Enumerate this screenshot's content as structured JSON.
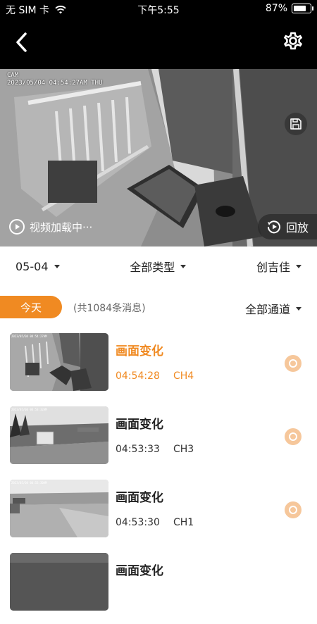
{
  "status_bar": {
    "carrier": "无 SIM 卡",
    "time": "下午5:55",
    "battery_percent": "87%",
    "battery_level": 0.87
  },
  "player": {
    "osd_name": "CAM",
    "osd_timestamp": "2023/05/04 04:54:27AM THU",
    "loading_text": "视频加载中···",
    "playback_label": "回放"
  },
  "filters": {
    "date": "05-04",
    "type": "全部类型",
    "brand": "创吉佳"
  },
  "summary": {
    "today_label": "今天",
    "count_text": "(共1084条消息)",
    "channel_filter": "全部通道"
  },
  "events": [
    {
      "title": "画面变化",
      "time": "04:54:28",
      "channel": "CH4",
      "active": true
    },
    {
      "title": "画面变化",
      "time": "04:53:33",
      "channel": "CH3",
      "active": false
    },
    {
      "title": "画面变化",
      "time": "04:53:30",
      "channel": "CH1",
      "active": false
    },
    {
      "title": "画面变化",
      "time": "",
      "channel": "",
      "active": false
    }
  ],
  "colors": {
    "accent": "#f08a22",
    "accent_light": "#f6c79b",
    "bar_background": "#000000"
  },
  "icons": {
    "back": "chevron-left-icon",
    "settings": "gear-icon",
    "save": "save-icon",
    "loading": "play-circle-icon",
    "playback": "replay-icon",
    "event_marker": "target-icon",
    "wifi": "wifi-icon",
    "battery": "battery-icon"
  }
}
